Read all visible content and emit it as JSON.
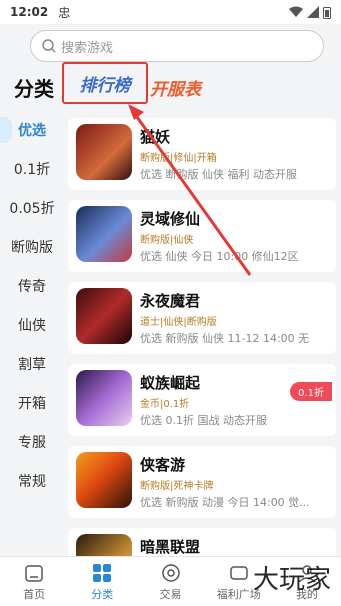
{
  "status": {
    "time": "12:02",
    "carrier": "忠"
  },
  "search": {
    "placeholder": "搜索游戏"
  },
  "tabs": {
    "category": "分类",
    "ranking": "排行榜",
    "servers": "开服表"
  },
  "sidebar": [
    "优选",
    "0.1折",
    "0.05折",
    "断购版",
    "传奇",
    "仙侠",
    "割草",
    "开箱",
    "专服",
    "常规"
  ],
  "games": [
    {
      "name": "猫妖",
      "sub": "断购版|修仙|开箱",
      "tags": "优选  断购版  仙侠   福利   动态开服",
      "badge": ""
    },
    {
      "name": "灵域修仙",
      "sub": "断购版|仙侠",
      "tags": "优选  仙侠     今日 10:00 修仙12区",
      "badge": ""
    },
    {
      "name": "永夜魔君",
      "sub": "道士|仙侠|断购版",
      "tags": "优选  新购版  仙侠     11-12 14:00 无",
      "badge": ""
    },
    {
      "name": "蚁族崛起",
      "sub": "金币|0.1折",
      "tags": "优选  0.1折  国战     动态开服",
      "badge": "0.1折"
    },
    {
      "name": "侠客游",
      "sub": "断购版|死神卡牌",
      "tags": "优选  新购版  动漫     今日 14:00 觉...",
      "badge": ""
    },
    {
      "name": "暗黑联盟",
      "sub": "",
      "tags": "",
      "badge": ""
    }
  ],
  "nav": [
    "首页",
    "分类",
    "交易",
    "福利广场",
    "我的"
  ],
  "watermark": "大玩家"
}
